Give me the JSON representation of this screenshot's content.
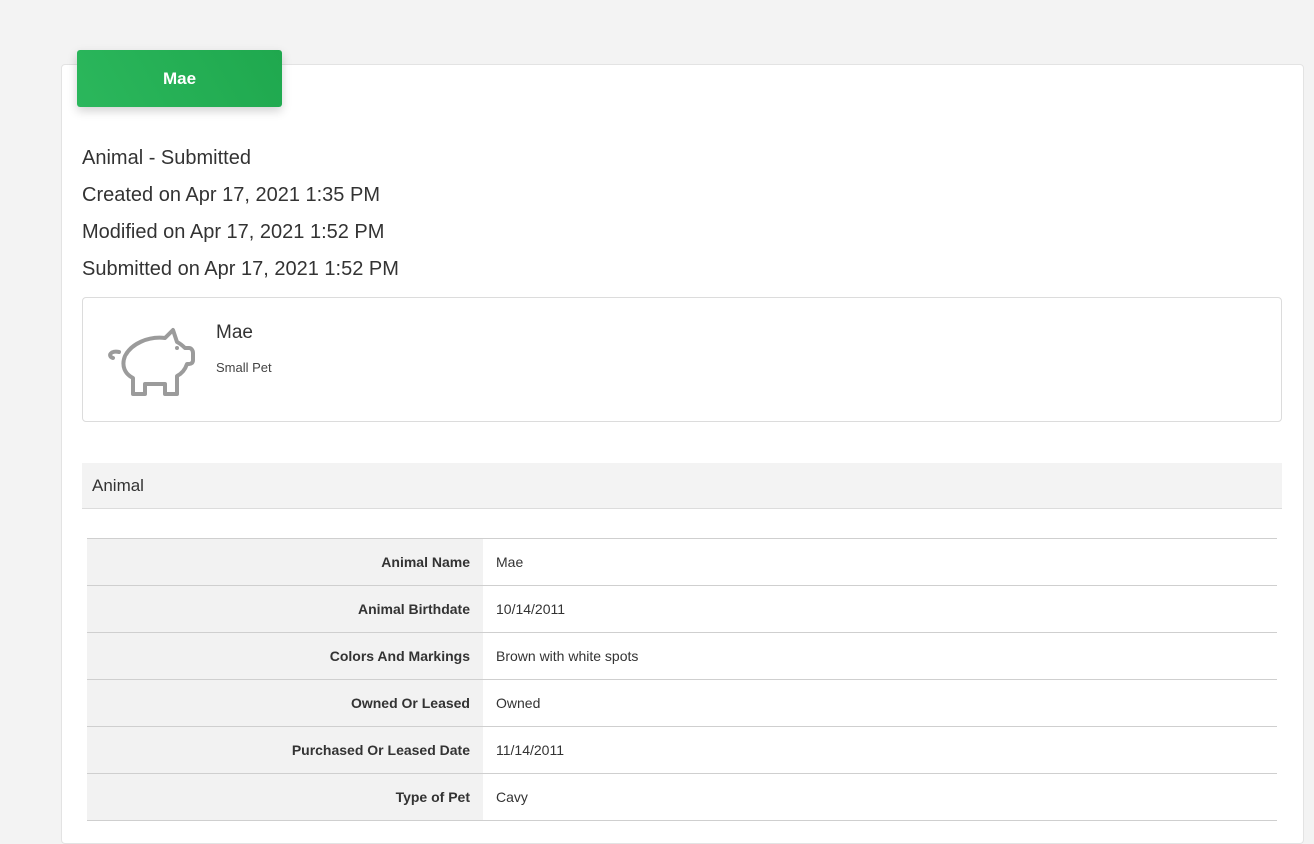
{
  "header": {
    "tab_label": "Mae"
  },
  "meta": {
    "status": "Animal - Submitted",
    "created": "Created on Apr 17, 2021 1:35 PM",
    "modified": "Modified on Apr 17, 2021 1:52 PM",
    "submitted": "Submitted on Apr 17, 2021 1:52 PM"
  },
  "pet_card": {
    "icon": "pig-icon",
    "name": "Mae",
    "type": "Small Pet"
  },
  "section": {
    "title": "Animal"
  },
  "fields": [
    {
      "label": "Animal Name",
      "value": "Mae"
    },
    {
      "label": "Animal Birthdate",
      "value": "10/14/2011"
    },
    {
      "label": "Colors And Markings",
      "value": "Brown with white spots"
    },
    {
      "label": "Owned Or Leased",
      "value": "Owned"
    },
    {
      "label": "Purchased Or Leased Date",
      "value": "11/14/2011"
    },
    {
      "label": "Type of Pet",
      "value": "Cavy"
    }
  ],
  "colors": {
    "accent": "#2bb75c",
    "page_bg": "#f3f3f3"
  }
}
